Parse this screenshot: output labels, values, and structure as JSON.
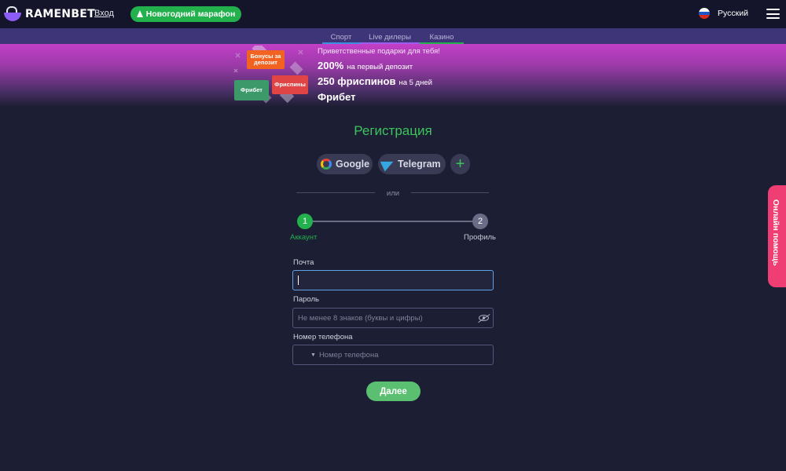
{
  "header": {
    "brand": "RAMENBET",
    "login": "Вход",
    "promo_button": "Новогодний марафон",
    "language": "Русский"
  },
  "nav": {
    "tabs": [
      {
        "label": "Спорт",
        "color": "#3b8fe0"
      },
      {
        "label": "Live дилеры",
        "color": "#9b5cf0"
      },
      {
        "label": "Казино",
        "color": "#22b14c"
      }
    ]
  },
  "banner": {
    "tiles": [
      "Бонусы за депозит",
      "Фрибет",
      "Фриспины"
    ],
    "welcome": "Приветственные подарки для тебя!",
    "offers": [
      {
        "main": "200%",
        "sub": "на первый депозит"
      },
      {
        "main": "250 фриспинов",
        "sub": "на 5 дней"
      },
      {
        "main": "Фрибет",
        "sub": ""
      }
    ]
  },
  "registration": {
    "title": "Регистрация",
    "social": [
      "Google",
      "Telegram"
    ],
    "or": "или",
    "steps": [
      {
        "number": "1",
        "label": "Аккаунт",
        "active": true
      },
      {
        "number": "2",
        "label": "Профиль",
        "active": false
      }
    ],
    "email": {
      "label": "Почта",
      "value": ""
    },
    "password": {
      "label": "Пароль",
      "placeholder": "Не менее 8 знаков (буквы и цифры)"
    },
    "phone": {
      "label": "Номер телефона",
      "placeholder": "Номер телефона"
    },
    "submit": "Далее"
  },
  "help": "Онлайн помощь",
  "colors": {
    "accent": "#22b14c",
    "help": "#ef3e73",
    "background": "#1c1e33"
  }
}
